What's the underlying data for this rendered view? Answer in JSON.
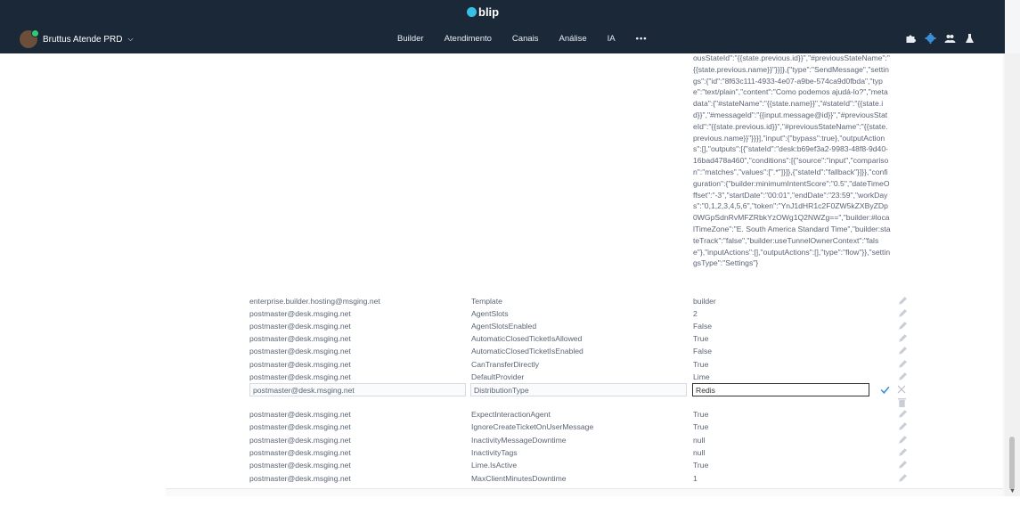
{
  "app": {
    "logo_text": "blip",
    "account_name": "Bruttus Atende PRD",
    "account_chevron": "⌵"
  },
  "nav": [
    {
      "label": "Builder"
    },
    {
      "label": "Atendimento"
    },
    {
      "label": "Canais"
    },
    {
      "label": "Análise"
    },
    {
      "label": "IA"
    },
    {
      "label": "•••"
    }
  ],
  "top_icons": [
    "puzzle-icon",
    "settings-gear-icon",
    "team-icon",
    "lab-flask-icon"
  ],
  "json_value": "ousStateId\":\"{{state.previous.id}}\",\"#previousStateName\":\"{{state.previous.name}}\"}}]},{\"type\":\"SendMessage\",\"settings\":{\"id\":\"8f63c111-4933-4e07-a9be-574ca9d0fbda\",\"type\":\"text/plain\",\"content\":\"Como podemos ajudá-lo?\",\"metadata\":{\"#stateName\":\"{{state.name}}\",\"#stateId\":\"{{state.id}}\",\"#messageId\":\"{{input.message@id}}\",\"#previousStateId\":\"{{state.previous.id}}\",\"#previousStateName\":\"{{state.previous.name}}\"}}}],\"input\":{\"bypass\":true},\"outputActions\":[],\"outputs\":[{\"stateId\":\"desk:b69ef3a2-9983-48f8-9d40-16bad478a460\",\"conditions\":[{\"source\":\"input\",\"comparison\":\"matches\",\"values\":[\".*\"]}]},{\"stateId\":\"fallback\"}]}},\"configuration\":{\"builder:minimumIntentScore\":\"0.5\",\"dateTimeOffset\":\"-3\",\"startDate\":\"00:01\",\"endDate\":\"23:59\",\"workDays\":\"0,1,2,3,4,5,6\",\"token\":\"YnJ1dHR1c2F0ZW5kZXByZDp0WGpSdnRvMFZRbkYzOWg1Q2NWZg==\",\"builder:#localTimeZone\":\"E. South America Standard Time\",\"builder:stateTrack\":\"false\",\"builder:useTunnelOwnerContext\":\"false\"},\"inputActions\":[],\"outputActions\":[],\"type\":\"flow\"}},\"settingsType\":\"Settings\"}",
  "rows_before": [
    {
      "owner": "enterprise.builder.hosting@msging.net",
      "name": "Template",
      "value": "builder"
    },
    {
      "owner": "postmaster@desk.msging.net",
      "name": "AgentSlots",
      "value": "2"
    },
    {
      "owner": "postmaster@desk.msging.net",
      "name": "AgentSlotsEnabled",
      "value": "False"
    },
    {
      "owner": "postmaster@desk.msging.net",
      "name": "AutomaticClosedTicketIsAllowed",
      "value": "True"
    },
    {
      "owner": "postmaster@desk.msging.net",
      "name": "AutomaticClosedTicketIsEnabled",
      "value": "False"
    },
    {
      "owner": "postmaster@desk.msging.net",
      "name": "CanTransferDirectly",
      "value": "True"
    },
    {
      "owner": "postmaster@desk.msging.net",
      "name": "DefaultProvider",
      "value": "Lime"
    }
  ],
  "edit_row": {
    "owner": "postmaster@desk.msging.net",
    "name": "DistributionType",
    "value": "Redis"
  },
  "rows_after": [
    {
      "owner": "postmaster@desk.msging.net",
      "name": "ExpectInteractionAgent",
      "value": "True"
    },
    {
      "owner": "postmaster@desk.msging.net",
      "name": "IgnoreCreateTicketOnUserMessage",
      "value": "True"
    },
    {
      "owner": "postmaster@desk.msging.net",
      "name": "InactivityMessageDowntime",
      "value": "null"
    },
    {
      "owner": "postmaster@desk.msging.net",
      "name": "InactivityTags",
      "value": "null"
    },
    {
      "owner": "postmaster@desk.msging.net",
      "name": "Lime.IsActive",
      "value": "True"
    },
    {
      "owner": "postmaster@desk.msging.net",
      "name": "MaxClientMinutesDowntime",
      "value": "1"
    }
  ],
  "colors": {
    "topbar": "#1a2838",
    "accent": "#36c0e6",
    "text": "#5a6475",
    "confirm": "#3a8fd6"
  }
}
